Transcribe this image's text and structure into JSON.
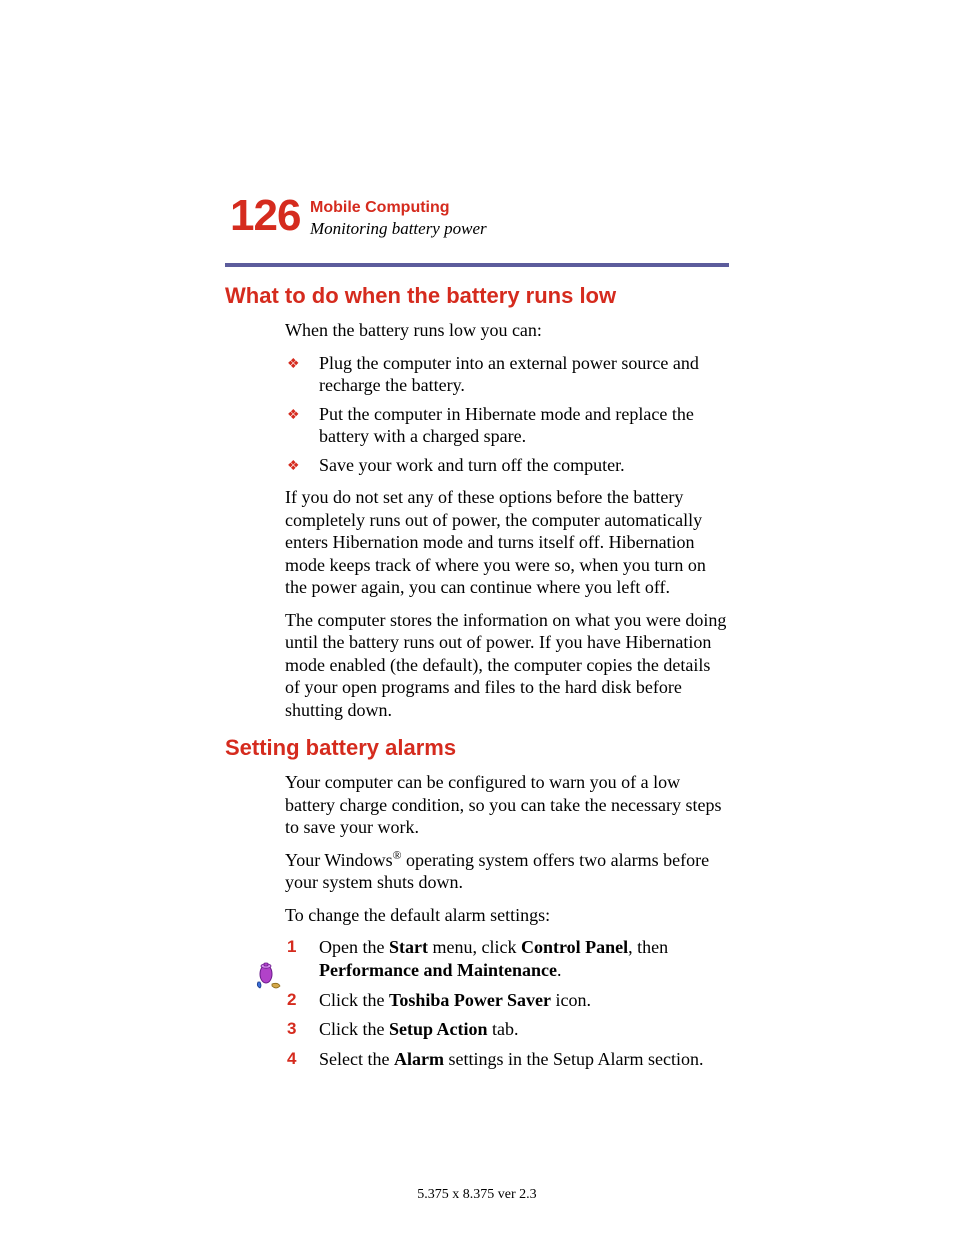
{
  "header": {
    "page_number": "126",
    "chapter": "Mobile Computing",
    "section": "Monitoring battery power"
  },
  "section1": {
    "heading": "What to do when the battery runs low",
    "intro": "When the battery runs low you can:",
    "bullets": [
      "Plug the computer into an external power source and recharge the battery.",
      "Put the computer in Hibernate mode and replace the battery with a charged spare.",
      "Save your work and turn off the computer."
    ],
    "para1": "If you do not set any of these options before the battery completely runs out of power, the computer automatically enters Hibernation mode and turns itself off. Hibernation mode keeps track of where you were so, when you turn on the power again, you can continue where you left off.",
    "para2": "The computer stores the information on what you were doing until the battery runs out of power. If you have Hibernation mode enabled (the default), the computer copies the details of your open programs and files to the hard disk before shutting down."
  },
  "section2": {
    "heading": "Setting battery alarms",
    "para1": "Your computer can be configured to warn you of a low battery charge condition, so you can take the necessary steps to save your work.",
    "para2_pre": "Your Windows",
    "para2_post": " operating system offers two alarms before your system shuts down.",
    "para3": "To change the default alarm settings:",
    "steps": {
      "s1_a": "Open the ",
      "s1_b": "Start",
      "s1_c": " menu, click ",
      "s1_d": "Control Panel",
      "s1_e": ", then ",
      "s1_f": "Performance and Maintenance",
      "s1_g": ".",
      "s2_a": "Click the ",
      "s2_b": "Toshiba Power Saver",
      "s2_c": " icon.",
      "s3_a": "Click the ",
      "s3_b": "Setup Action",
      "s3_c": " tab.",
      "s4_a": "Select the ",
      "s4_b": "Alarm",
      "s4_c": " settings in the Setup Alarm section."
    },
    "num1": "1",
    "num2": "2",
    "num3": "3",
    "num4": "4"
  },
  "footer": "5.375 x 8.375 ver 2.3",
  "reg_mark": "®"
}
